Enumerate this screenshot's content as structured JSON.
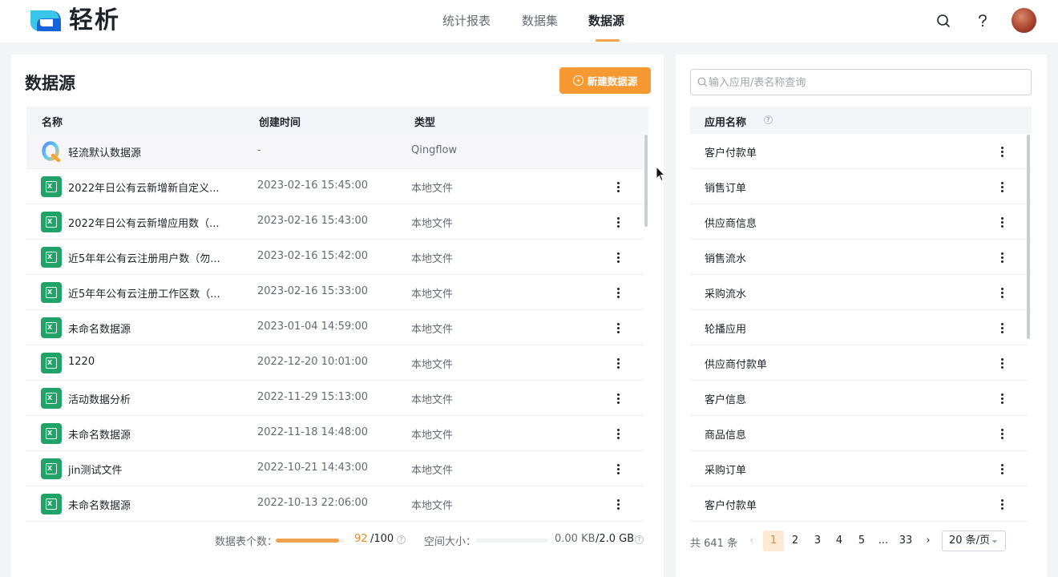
{
  "header": {
    "logo_text": "轻析",
    "nav": [
      {
        "label": "统计报表",
        "active": false
      },
      {
        "label": "数据集",
        "active": false
      },
      {
        "label": "数据源",
        "active": true
      }
    ],
    "icons": [
      "search-icon",
      "help-icon",
      "avatar"
    ]
  },
  "left": {
    "title": "数据源",
    "new_button": "新建数据源",
    "columns": {
      "name": "名称",
      "created": "创建时间",
      "type": "类型"
    },
    "rows": [
      {
        "name": "轻流默认数据源",
        "created": "-",
        "type": "Qingflow",
        "icon": "qingflow-icon"
      },
      {
        "name": "2022年日公有云新增新自定义...",
        "created": "2023-02-16 15:45:00",
        "type": "本地文件",
        "icon": "excel-file-icon"
      },
      {
        "name": "2022年日公有云新增应用数（...",
        "created": "2023-02-16 15:43:00",
        "type": "本地文件",
        "icon": "excel-file-icon"
      },
      {
        "name": "近5年年公有云注册用户数（勿...",
        "created": "2023-02-16 15:42:00",
        "type": "本地文件",
        "icon": "excel-file-icon"
      },
      {
        "name": "近5年年公有云注册工作区数（...",
        "created": "2023-02-16 15:33:00",
        "type": "本地文件",
        "icon": "excel-file-icon"
      },
      {
        "name": "未命名数据源",
        "created": "2023-01-04 14:59:00",
        "type": "本地文件",
        "icon": "excel-file-icon"
      },
      {
        "name": "1220",
        "created": "2022-12-20 10:01:00",
        "type": "本地文件",
        "icon": "excel-file-icon"
      },
      {
        "name": "活动数据分析",
        "created": "2022-11-29 15:13:00",
        "type": "本地文件",
        "icon": "excel-file-icon"
      },
      {
        "name": "未命名数据源",
        "created": "2022-11-18 14:48:00",
        "type": "本地文件",
        "icon": "excel-file-icon"
      },
      {
        "name": "jin测试文件",
        "created": "2022-10-21 14:43:00",
        "type": "本地文件",
        "icon": "excel-file-icon"
      },
      {
        "name": "未命名数据源",
        "created": "2022-10-13 22:06:00",
        "type": "本地文件",
        "icon": "excel-file-icon"
      }
    ],
    "footer": {
      "table_count_label": "数据表个数：",
      "table_count_used": "92",
      "table_count_total": "/100",
      "table_count_fraction": 0.92,
      "space_label": "空间大小：",
      "space_used": "0.00 KB",
      "space_total": "/2.0 GB",
      "space_fraction": 0.0
    }
  },
  "right": {
    "search_placeholder": "输入应用/表名称查询",
    "column": "应用名称",
    "apps": [
      "客户付款单",
      "销售订单",
      "供应商信息",
      "销售流水",
      "采购流水",
      "轮播应用",
      "供应商付款单",
      "客户信息",
      "商品信息",
      "采购订单",
      "客户付款单"
    ],
    "pagination": {
      "total": "共 641 条",
      "pages": [
        "1",
        "2",
        "3",
        "4",
        "5"
      ],
      "ellipsis": "...",
      "last": "33",
      "current": "1",
      "page_size": "20 条/页"
    }
  },
  "colors": {
    "accent": "#f79933",
    "excel": "#20a366",
    "progress": "#f0a24c"
  }
}
